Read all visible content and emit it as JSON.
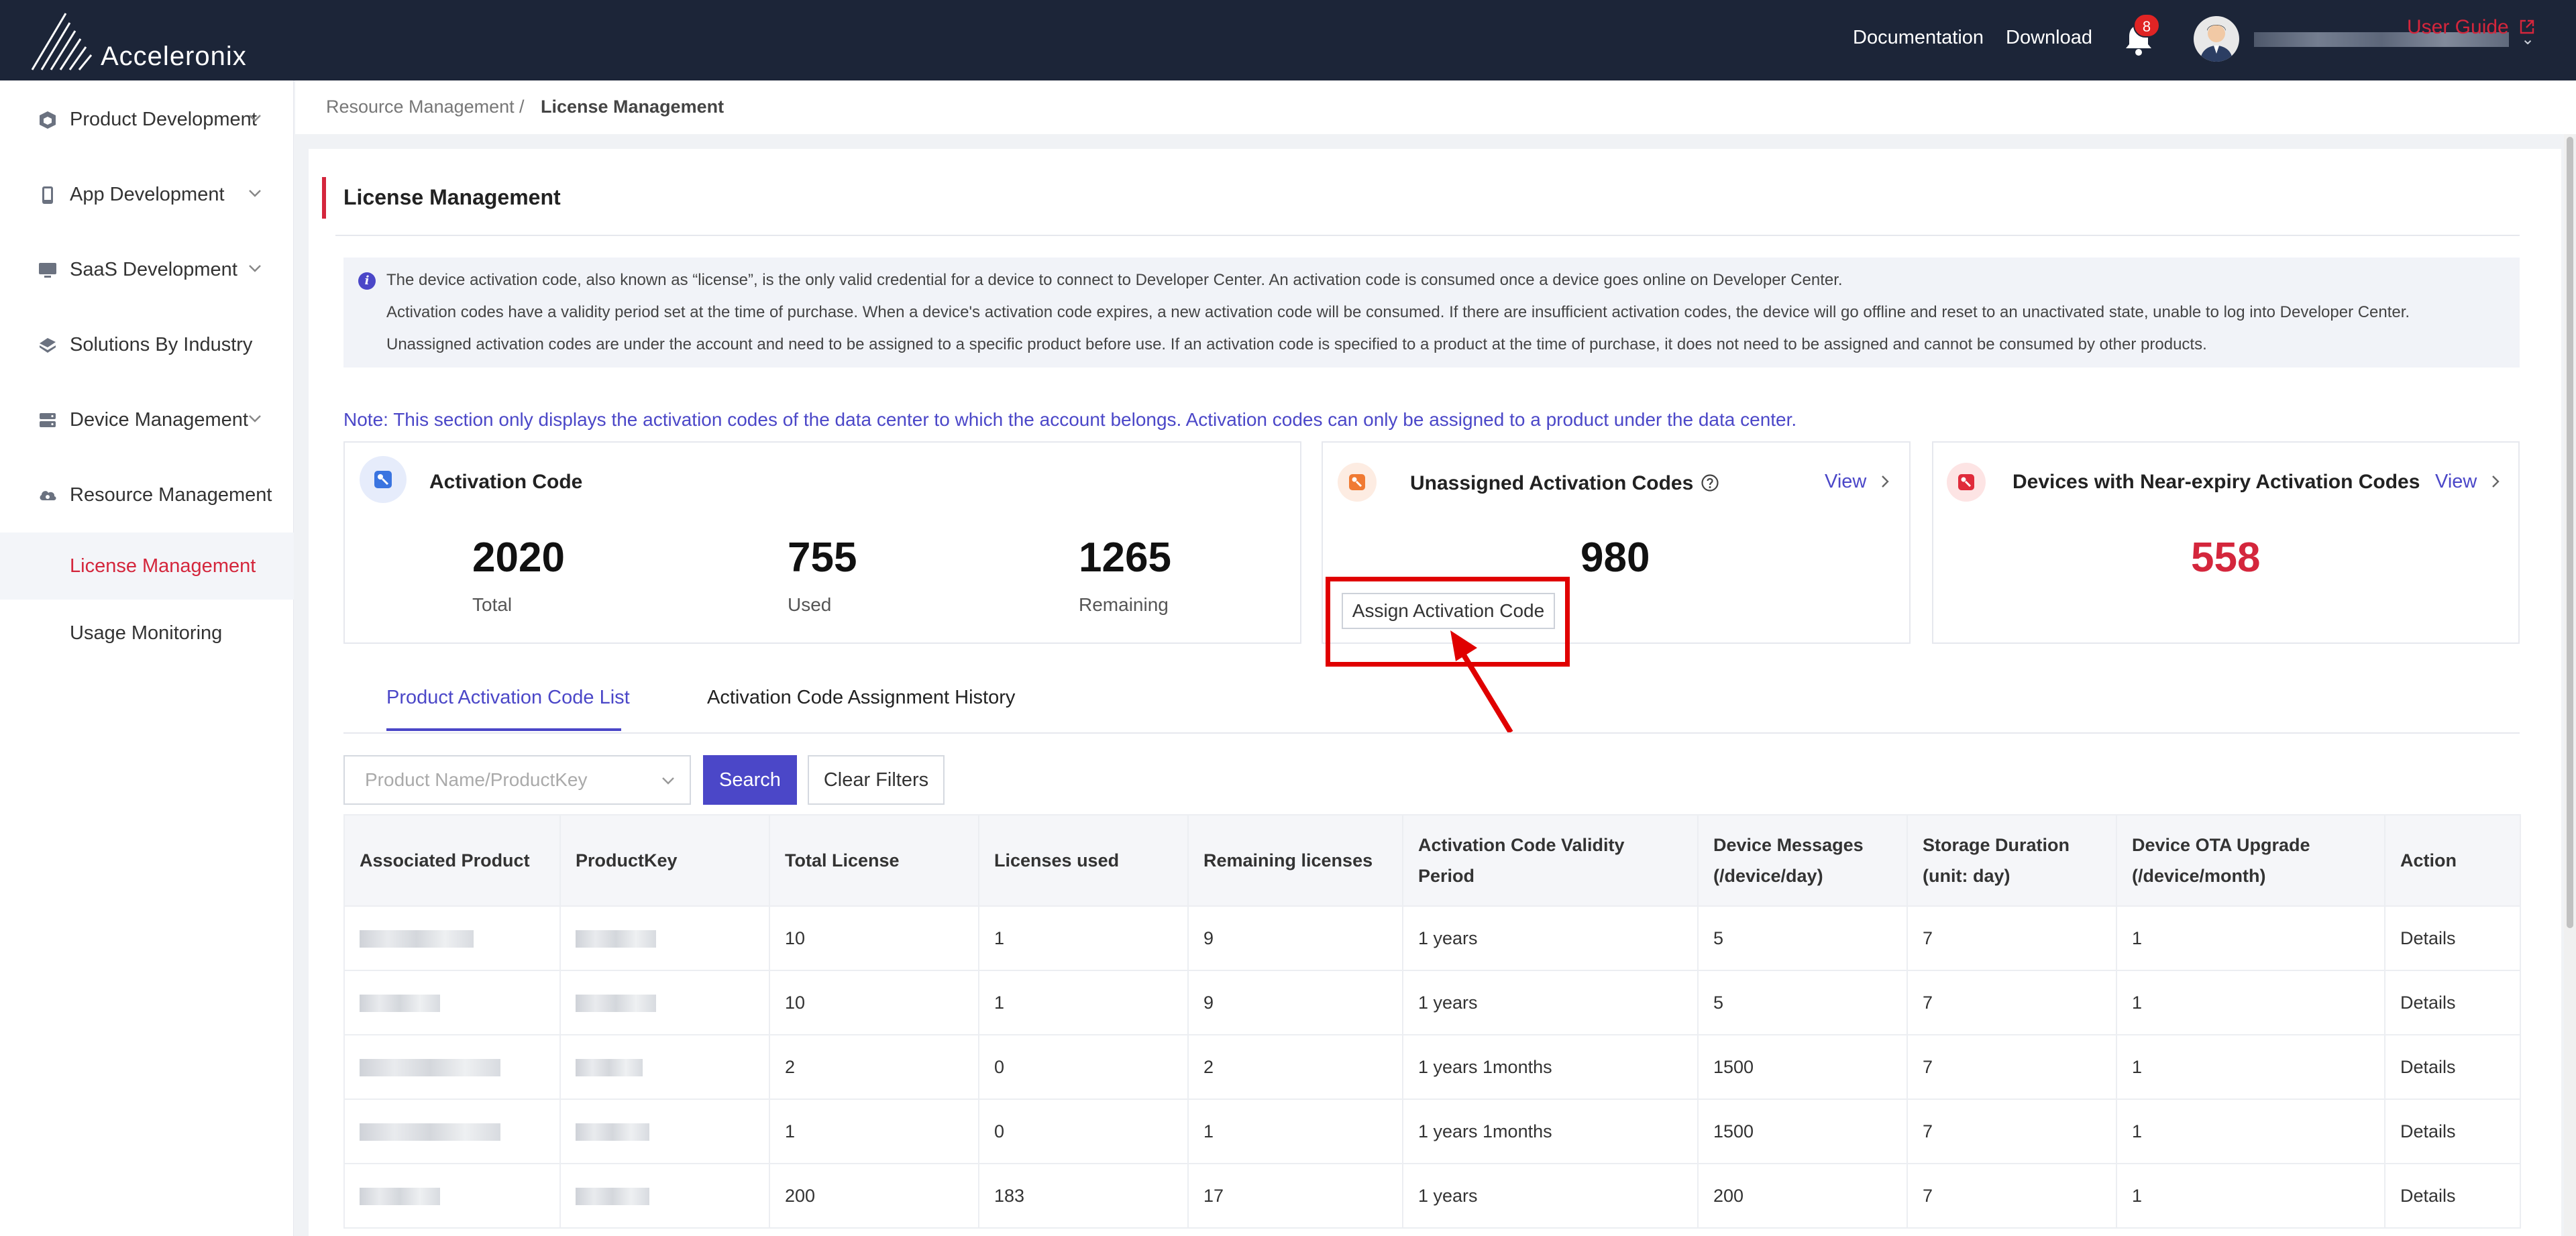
{
  "header": {
    "brand": "Acceleronix",
    "links": [
      "Documentation",
      "Download"
    ],
    "notification_count": "8"
  },
  "sidebar": {
    "items": [
      {
        "label": "Product Development",
        "icon": "cube-icon"
      },
      {
        "label": "App Development",
        "icon": "phone-icon"
      },
      {
        "label": "SaaS Development",
        "icon": "monitor-icon"
      },
      {
        "label": "Solutions By Industry",
        "icon": "layers-icon"
      },
      {
        "label": "Device Management",
        "icon": "server-icon"
      },
      {
        "label": "Resource Management",
        "icon": "cloud-gear-icon"
      }
    ],
    "subitems": [
      "License Management",
      "Usage Monitoring"
    ]
  },
  "breadcrumb": {
    "parent": "Resource Management",
    "separator": "/",
    "current": "License Management",
    "user_guide": "User Guide"
  },
  "page": {
    "title": "License Management",
    "notice": [
      "The device activation code, also known as “license”, is the only valid credential for a device to connect to Developer Center. An activation code is consumed once a device goes online on Developer Center.",
      "Activation codes have a validity period set at the time of purchase. When a device's activation code expires, a new activation code will be consumed. If there are insufficient activation codes, the device will go offline and reset to an unactivated state, unable to log into Developer Center.",
      "Unassigned activation codes are under the account and need to be assigned to a specific product before use. If an activation code is specified to a product at the time of purchase, it does not need to be assigned and cannot be consumed by other products."
    ],
    "note": "Note: This section only displays the activation codes of the data center to which the account belongs. Activation codes can only be assigned to a product under the data center."
  },
  "cards": {
    "activation": {
      "title": "Activation Code",
      "stats": [
        {
          "value": "2020",
          "label": "Total"
        },
        {
          "value": "755",
          "label": "Used"
        },
        {
          "value": "1265",
          "label": "Remaining"
        }
      ]
    },
    "unassigned": {
      "title": "Unassigned Activation Codes",
      "value": "980",
      "view": "View",
      "assign_button": "Assign Activation Code"
    },
    "near_expiry": {
      "title": "Devices with Near-expiry Activation Codes",
      "value": "558",
      "view": "View"
    }
  },
  "tabs": [
    "Product Activation Code List",
    "Activation Code Assignment History"
  ],
  "filters": {
    "placeholder": "Product Name/ProductKey",
    "search": "Search",
    "clear": "Clear Filters"
  },
  "table": {
    "headers": [
      "Associated Product",
      "ProductKey",
      "Total License",
      "Licenses used",
      "Remaining licenses",
      "Activation Code Validity Period",
      "Device Messages (/device/day)",
      "Storage Duration (unit: day)",
      "Device OTA Upgrade (/device/month)",
      "Action"
    ],
    "rows": [
      {
        "total": "10",
        "used": "1",
        "remaining": "9",
        "validity": "1 years",
        "messages": "5",
        "storage": "7",
        "ota": "1",
        "action": "Details"
      },
      {
        "total": "10",
        "used": "1",
        "remaining": "9",
        "validity": "1 years",
        "messages": "5",
        "storage": "7",
        "ota": "1",
        "action": "Details"
      },
      {
        "total": "2",
        "used": "0",
        "remaining": "2",
        "validity": "1 years 1months",
        "messages": "1500",
        "storage": "7",
        "ota": "1",
        "action": "Details"
      },
      {
        "total": "1",
        "used": "0",
        "remaining": "1",
        "validity": "1 years 1months",
        "messages": "1500",
        "storage": "7",
        "ota": "1",
        "action": "Details"
      },
      {
        "total": "200",
        "used": "183",
        "remaining": "17",
        "validity": "1 years",
        "messages": "200",
        "storage": "7",
        "ota": "1",
        "action": "Details"
      }
    ]
  },
  "colors": {
    "topbar": "#1c2538",
    "accent": "#4b47c8",
    "brand_red": "#d4263c",
    "highlight": "#e00000"
  }
}
